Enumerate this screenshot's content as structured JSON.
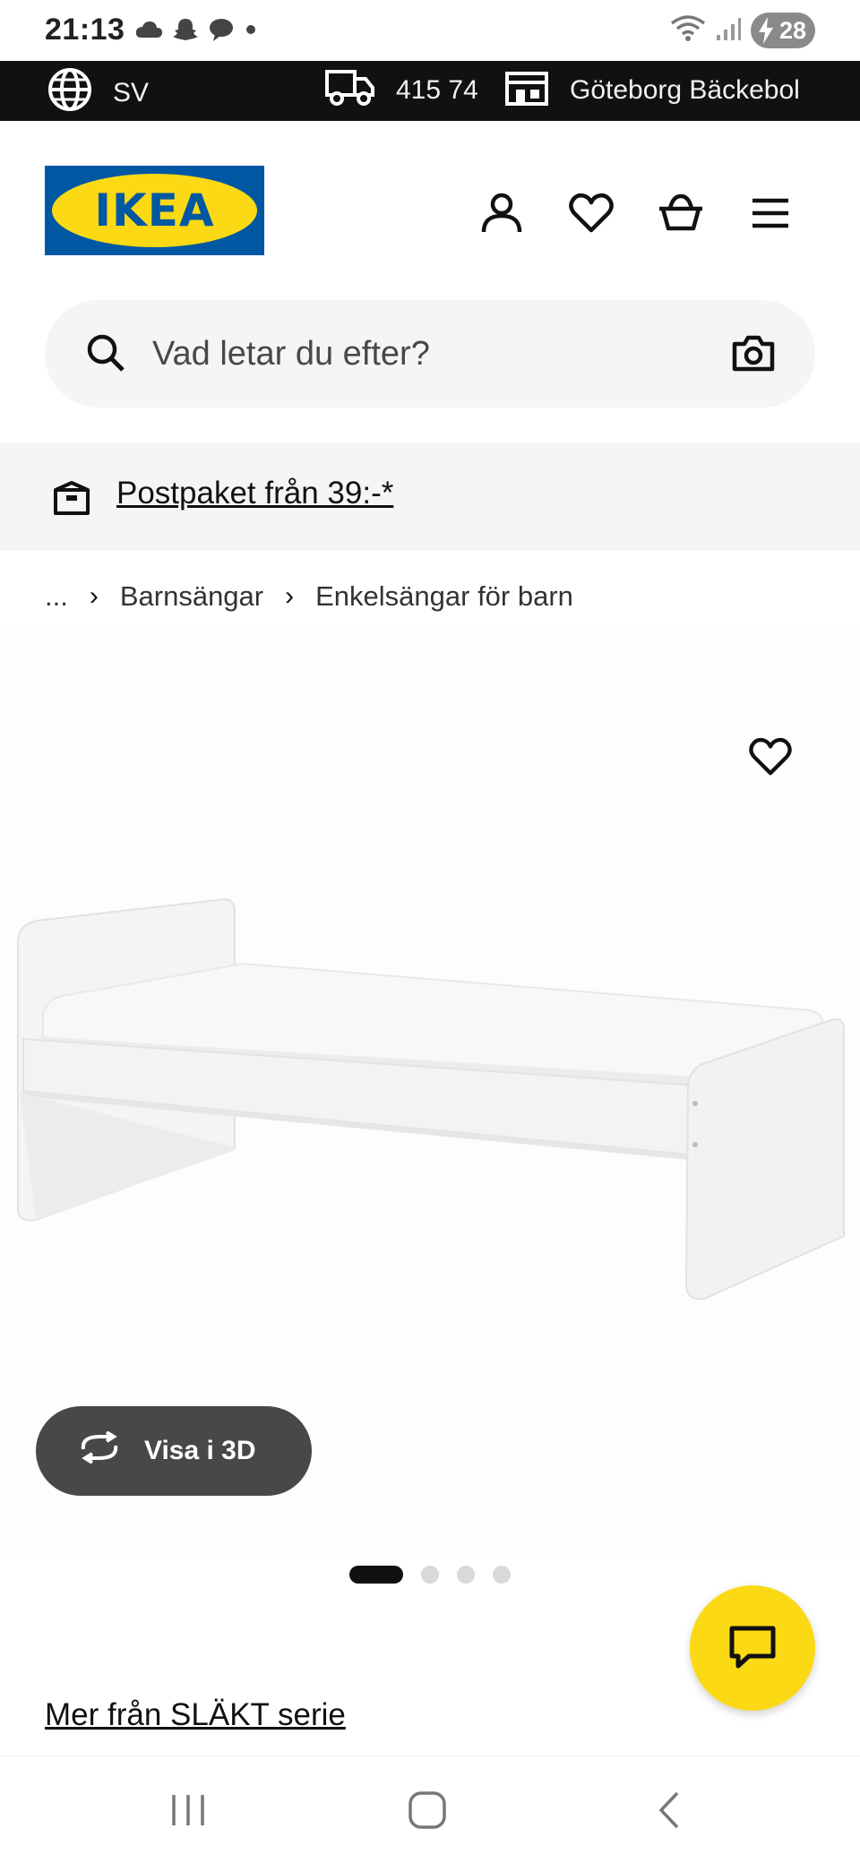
{
  "status_bar": {
    "time": "21:13",
    "battery": "28",
    "left_icons": [
      "cloud-icon",
      "snapchat-icon",
      "chat-bubble-icon",
      "dot-icon"
    ],
    "right_icons": [
      "wifi-icon",
      "signal-icon",
      "battery-icon"
    ]
  },
  "top_bar": {
    "language": "SV",
    "postcode": "415 74",
    "store": "Göteborg Bäckebol",
    "icons": [
      "globe-icon",
      "truck-icon",
      "store-icon"
    ]
  },
  "header": {
    "logo_text": "IKEA",
    "icons": [
      "account-icon",
      "heart-icon",
      "basket-icon",
      "menu-icon"
    ]
  },
  "search": {
    "placeholder": "Vad letar du efter?",
    "icons": [
      "search-icon",
      "camera-icon"
    ]
  },
  "promo": {
    "text": "Postpaket från 39:-*"
  },
  "breadcrumb": {
    "items": [
      "...",
      "Barnsängar",
      "Enkelsängar för barn"
    ]
  },
  "gallery": {
    "view_3d_label": "Visa i 3D",
    "pages": 4,
    "current_page": 1
  },
  "series_link": "Mer från SLÄKT serie",
  "colors": {
    "brand_blue": "#0058a3",
    "brand_yellow": "#fbd914",
    "dark": "#111111",
    "button_gray": "#484848",
    "light_bg": "#f5f5f5"
  }
}
